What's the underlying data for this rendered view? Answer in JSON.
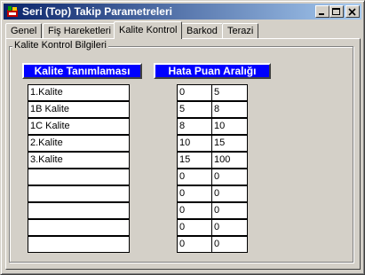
{
  "window": {
    "title": "Seri (Top) Takip Parametreleri"
  },
  "tabs": [
    {
      "label": "Genel",
      "active": false
    },
    {
      "label": "Fiş Hareketleri",
      "active": false
    },
    {
      "label": "Kalite Kontrol",
      "active": true
    },
    {
      "label": "Barkod",
      "active": false
    },
    {
      "label": "Terazi",
      "active": false
    }
  ],
  "group": {
    "label": "Kalite Kontrol Bilgileri"
  },
  "quality": {
    "header": "Kalite Tanımlaması",
    "items": [
      "1.Kalite",
      "1B Kalite",
      "1C Kalite",
      "2.Kalite",
      "3.Kalite",
      "",
      "",
      "",
      "",
      ""
    ]
  },
  "range": {
    "header": "Hata Puan Aralığı",
    "rows": [
      [
        "0",
        "5"
      ],
      [
        "5",
        "8"
      ],
      [
        "8",
        "10"
      ],
      [
        "10",
        "15"
      ],
      [
        "15",
        "100"
      ],
      [
        "0",
        "0"
      ],
      [
        "0",
        "0"
      ],
      [
        "0",
        "0"
      ],
      [
        "0",
        "0"
      ],
      [
        "0",
        "0"
      ]
    ]
  },
  "colors": {
    "title_start": "#0a246a",
    "title_end": "#a6caf0",
    "header_blue": "#0000ff",
    "face": "#d4d0c8"
  }
}
